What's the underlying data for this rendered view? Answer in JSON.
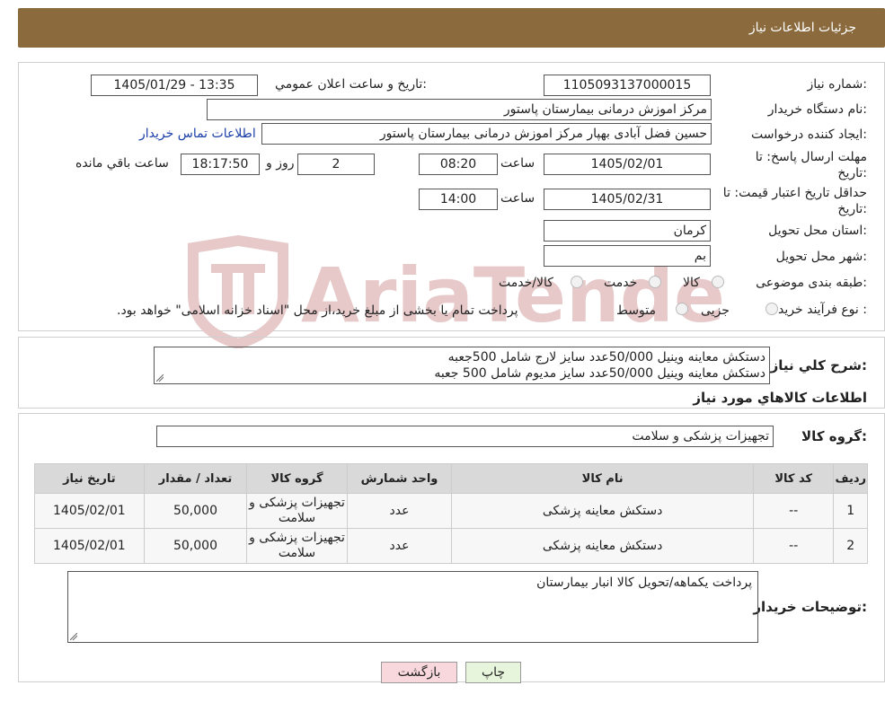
{
  "header": {
    "title": "جزئیات اطلاعات نیاز"
  },
  "fields": {
    "need_number_label": "شماره نیاز:",
    "need_number": "1105093137000015",
    "announce_label": "تاریخ و ساعت اعلان عمومي:",
    "announce_value": "1405/01/29 - 13:35",
    "buyer_org_label": "نام دستگاه خریدار:",
    "buyer_org": "مرکز اموزش درمانی بیمارستان پاستور",
    "requester_label": "ایجاد کننده درخواست:",
    "requester": "حسین فضل آبادی بهپار مرکز اموزش درمانی بیمارستان پاستور",
    "contact_link": "اطلاعات تماس خریدار",
    "deadline_label": "مهلت ارسال پاسخ: تا تاریخ:",
    "deadline_date": "1405/02/01",
    "time_label": "ساعت",
    "deadline_time": "08:20",
    "days_value": "2",
    "days_label": "روز و",
    "remaining_time": "18:17:50",
    "remaining_label": "ساعت باقي مانده",
    "validity_label": "حداقل تاریخ اعتبار قیمت: تا تاریخ:",
    "validity_date": "1405/02/31",
    "validity_time": "14:00",
    "province_label": "استان محل تحویل:",
    "province": "کرمان",
    "city_label": "شهر محل تحویل:",
    "city": "بم",
    "category_label": "طبقه بندی موضوعی:",
    "category_options": [
      "کالا",
      "خدمت",
      "کالا/خدمت"
    ],
    "process_label": "نوع فرآیند خرید :",
    "process_options": [
      "جزیی",
      "متوسط"
    ],
    "process_note": "پرداخت تمام یا بخشی از مبلغ خرید،از محل \"اسناد خزانه اسلامی\" خواهد بود."
  },
  "description": {
    "label": "شرح كلي نياز:",
    "lines": [
      "دستکش معاینه وینیل 50/000عدد سایز لارج شامل 500جعبه",
      "دستکش معاینه وینیل 50/000عدد سایز مدیوم شامل 500 جعبه"
    ]
  },
  "goods": {
    "section_title": "اطلاعات كالاهاي مورد نياز",
    "group_label": "گروه کالا:",
    "group_value": "تجهیزات پزشکی و سلامت",
    "columns": [
      "رديف",
      "کد کالا",
      "نام کالا",
      "واحد شمارش",
      "گروه کالا",
      "تعداد / مقدار",
      "تاریخ نیاز"
    ],
    "rows": [
      [
        "1",
        "--",
        "دستکش معاینه پزشکی",
        "عدد",
        "تجهیزات پزشکی و سلامت",
        "50,000",
        "1405/02/01"
      ],
      [
        "2",
        "--",
        "دستکش معاینه پزشکی",
        "عدد",
        "تجهیزات پزشکی و سلامت",
        "50,000",
        "1405/02/01"
      ]
    ]
  },
  "notes": {
    "label": "توضیحات خریدار:",
    "text": "پرداخت یکماهه/تحویل کالا انبار بیمارستان"
  },
  "buttons": {
    "print": "چاپ",
    "back": "بازگشت"
  },
  "watermark": {
    "text": "AriaTender.neT"
  },
  "colors": {
    "header_bg": "#8b6a3e",
    "link": "#1a3fa8",
    "print_btn": "#e6f5dc",
    "back_btn": "#f8d8dc",
    "watermark": "#e7c9c9"
  }
}
